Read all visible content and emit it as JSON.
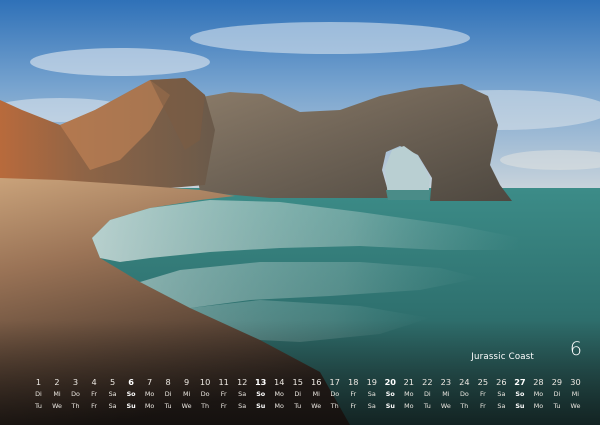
{
  "calendar": {
    "caption": "Jurassic Coast",
    "month": "6",
    "days": [
      {
        "num": "1",
        "wd1": "Di",
        "wd2": "Tu"
      },
      {
        "num": "2",
        "wd1": "Mi",
        "wd2": "We"
      },
      {
        "num": "3",
        "wd1": "Do",
        "wd2": "Th"
      },
      {
        "num": "4",
        "wd1": "Fr",
        "wd2": "Fr"
      },
      {
        "num": "5",
        "wd1": "Sa",
        "wd2": "Sa"
      },
      {
        "num": "6",
        "wd1": "So",
        "wd2": "Su",
        "weekend": true
      },
      {
        "num": "7",
        "wd1": "Mo",
        "wd2": "Mo"
      },
      {
        "num": "8",
        "wd1": "Di",
        "wd2": "Tu"
      },
      {
        "num": "9",
        "wd1": "Mi",
        "wd2": "We"
      },
      {
        "num": "10",
        "wd1": "Do",
        "wd2": "Th"
      },
      {
        "num": "11",
        "wd1": "Fr",
        "wd2": "Fr"
      },
      {
        "num": "12",
        "wd1": "Sa",
        "wd2": "Sa"
      },
      {
        "num": "13",
        "wd1": "So",
        "wd2": "Su",
        "weekend": true
      },
      {
        "num": "14",
        "wd1": "Mo",
        "wd2": "Mo"
      },
      {
        "num": "15",
        "wd1": "Di",
        "wd2": "Tu"
      },
      {
        "num": "16",
        "wd1": "Mi",
        "wd2": "We"
      },
      {
        "num": "17",
        "wd1": "Do",
        "wd2": "Th"
      },
      {
        "num": "18",
        "wd1": "Fr",
        "wd2": "Fr"
      },
      {
        "num": "19",
        "wd1": "Sa",
        "wd2": "Sa"
      },
      {
        "num": "20",
        "wd1": "So",
        "wd2": "Su",
        "weekend": true
      },
      {
        "num": "21",
        "wd1": "Mo",
        "wd2": "Mo"
      },
      {
        "num": "22",
        "wd1": "Di",
        "wd2": "Tu"
      },
      {
        "num": "23",
        "wd1": "Mi",
        "wd2": "We"
      },
      {
        "num": "24",
        "wd1": "Do",
        "wd2": "Th"
      },
      {
        "num": "25",
        "wd1": "Fr",
        "wd2": "Fr"
      },
      {
        "num": "26",
        "wd1": "Sa",
        "wd2": "Sa"
      },
      {
        "num": "27",
        "wd1": "So",
        "wd2": "Su",
        "weekend": true
      },
      {
        "num": "28",
        "wd1": "Mo",
        "wd2": "Mo"
      },
      {
        "num": "29",
        "wd1": "Di",
        "wd2": "Tu"
      },
      {
        "num": "30",
        "wd1": "Mi",
        "wd2": "We"
      }
    ]
  }
}
